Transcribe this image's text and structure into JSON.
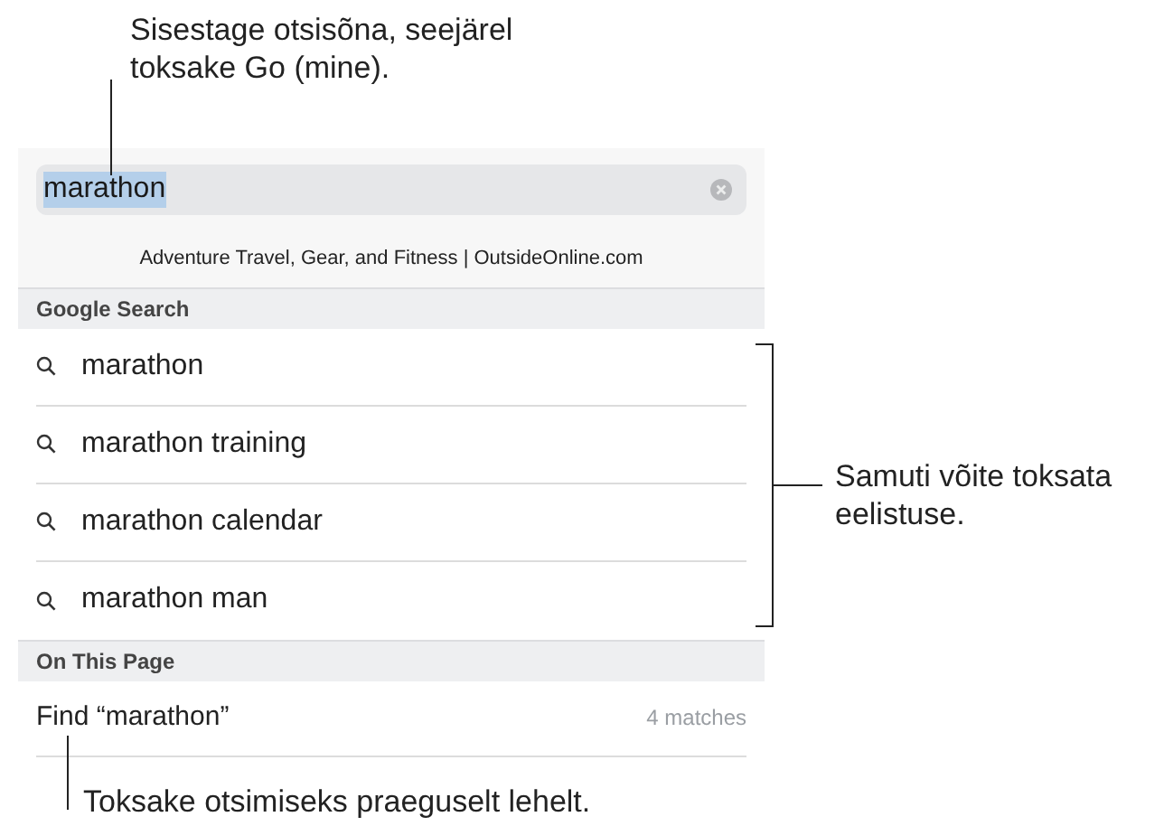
{
  "callouts": [
    {
      "text": "Sisestage otsisõna, seejärel toksake Go (mine)."
    },
    {
      "text": "Samuti võite toksata eelistuse."
    },
    {
      "text": "Toksake otsimiseks praeguselt lehelt."
    }
  ],
  "search": {
    "value": "marathon",
    "text_selected": true
  },
  "top_hit": "Adventure Travel, Gear, and Fitness | OutsideOnline.com",
  "sections": [
    {
      "header": "Google Search",
      "rows": [
        {
          "kind": "suggestion",
          "label": "marathon"
        },
        {
          "kind": "suggestion",
          "label": "marathon training"
        },
        {
          "kind": "suggestion",
          "label": "marathon calendar"
        },
        {
          "kind": "suggestion",
          "label": "marathon man"
        }
      ]
    },
    {
      "header": "On This Page",
      "rows": [
        {
          "kind": "find",
          "label": "Find “marathon”",
          "count": "4 matches"
        }
      ]
    }
  ]
}
